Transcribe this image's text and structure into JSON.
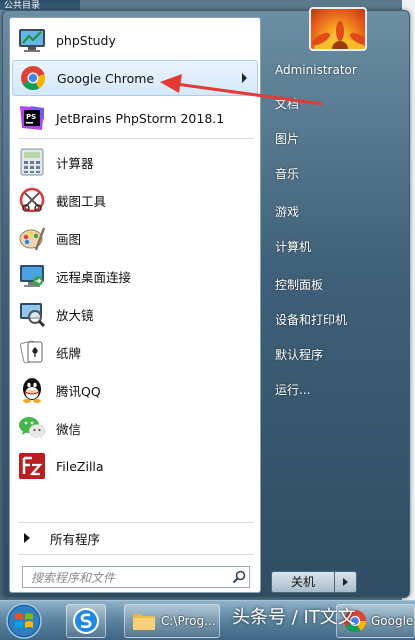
{
  "desktop": {
    "top_text": "公共目录"
  },
  "user": {
    "name": "Administrator"
  },
  "programs": [
    {
      "label": "phpStudy",
      "icon": "phpstudy-icon"
    },
    {
      "label": "Google Chrome",
      "icon": "chrome-icon",
      "has_submenu": true
    },
    {
      "label": "JetBrains PhpStorm 2018.1",
      "icon": "phpstorm-icon"
    },
    {
      "label": "计算器",
      "icon": "calculator-icon"
    },
    {
      "label": "截图工具",
      "icon": "snipping-tool-icon"
    },
    {
      "label": "画图",
      "icon": "paint-icon"
    },
    {
      "label": "远程桌面连接",
      "icon": "remote-desktop-icon"
    },
    {
      "label": "放大镜",
      "icon": "magnifier-icon"
    },
    {
      "label": "纸牌",
      "icon": "solitaire-icon"
    },
    {
      "label": "腾讯QQ",
      "icon": "qq-icon"
    },
    {
      "label": "微信",
      "icon": "wechat-icon"
    },
    {
      "label": "FileZilla",
      "icon": "filezilla-icon"
    }
  ],
  "all_programs_label": "所有程序",
  "search": {
    "placeholder": "搜索程序和文件"
  },
  "right_items": [
    "Administrator",
    "文档",
    "图片",
    "音乐",
    "游戏",
    "计算机",
    "控制面板",
    "设备和打印机",
    "默认程序",
    "运行..."
  ],
  "shutdown_label": "关机",
  "taskbar": {
    "items": [
      {
        "label": "",
        "icon": "sogou-icon"
      },
      {
        "label": "C:\\Prog...",
        "icon": "folder-icon"
      },
      {
        "label": "Google",
        "icon": "chrome-icon"
      }
    ],
    "watermark": "头条号 / IT文文"
  },
  "colors": {
    "annotation": "#e53935",
    "hover": "#d4e8fa"
  }
}
